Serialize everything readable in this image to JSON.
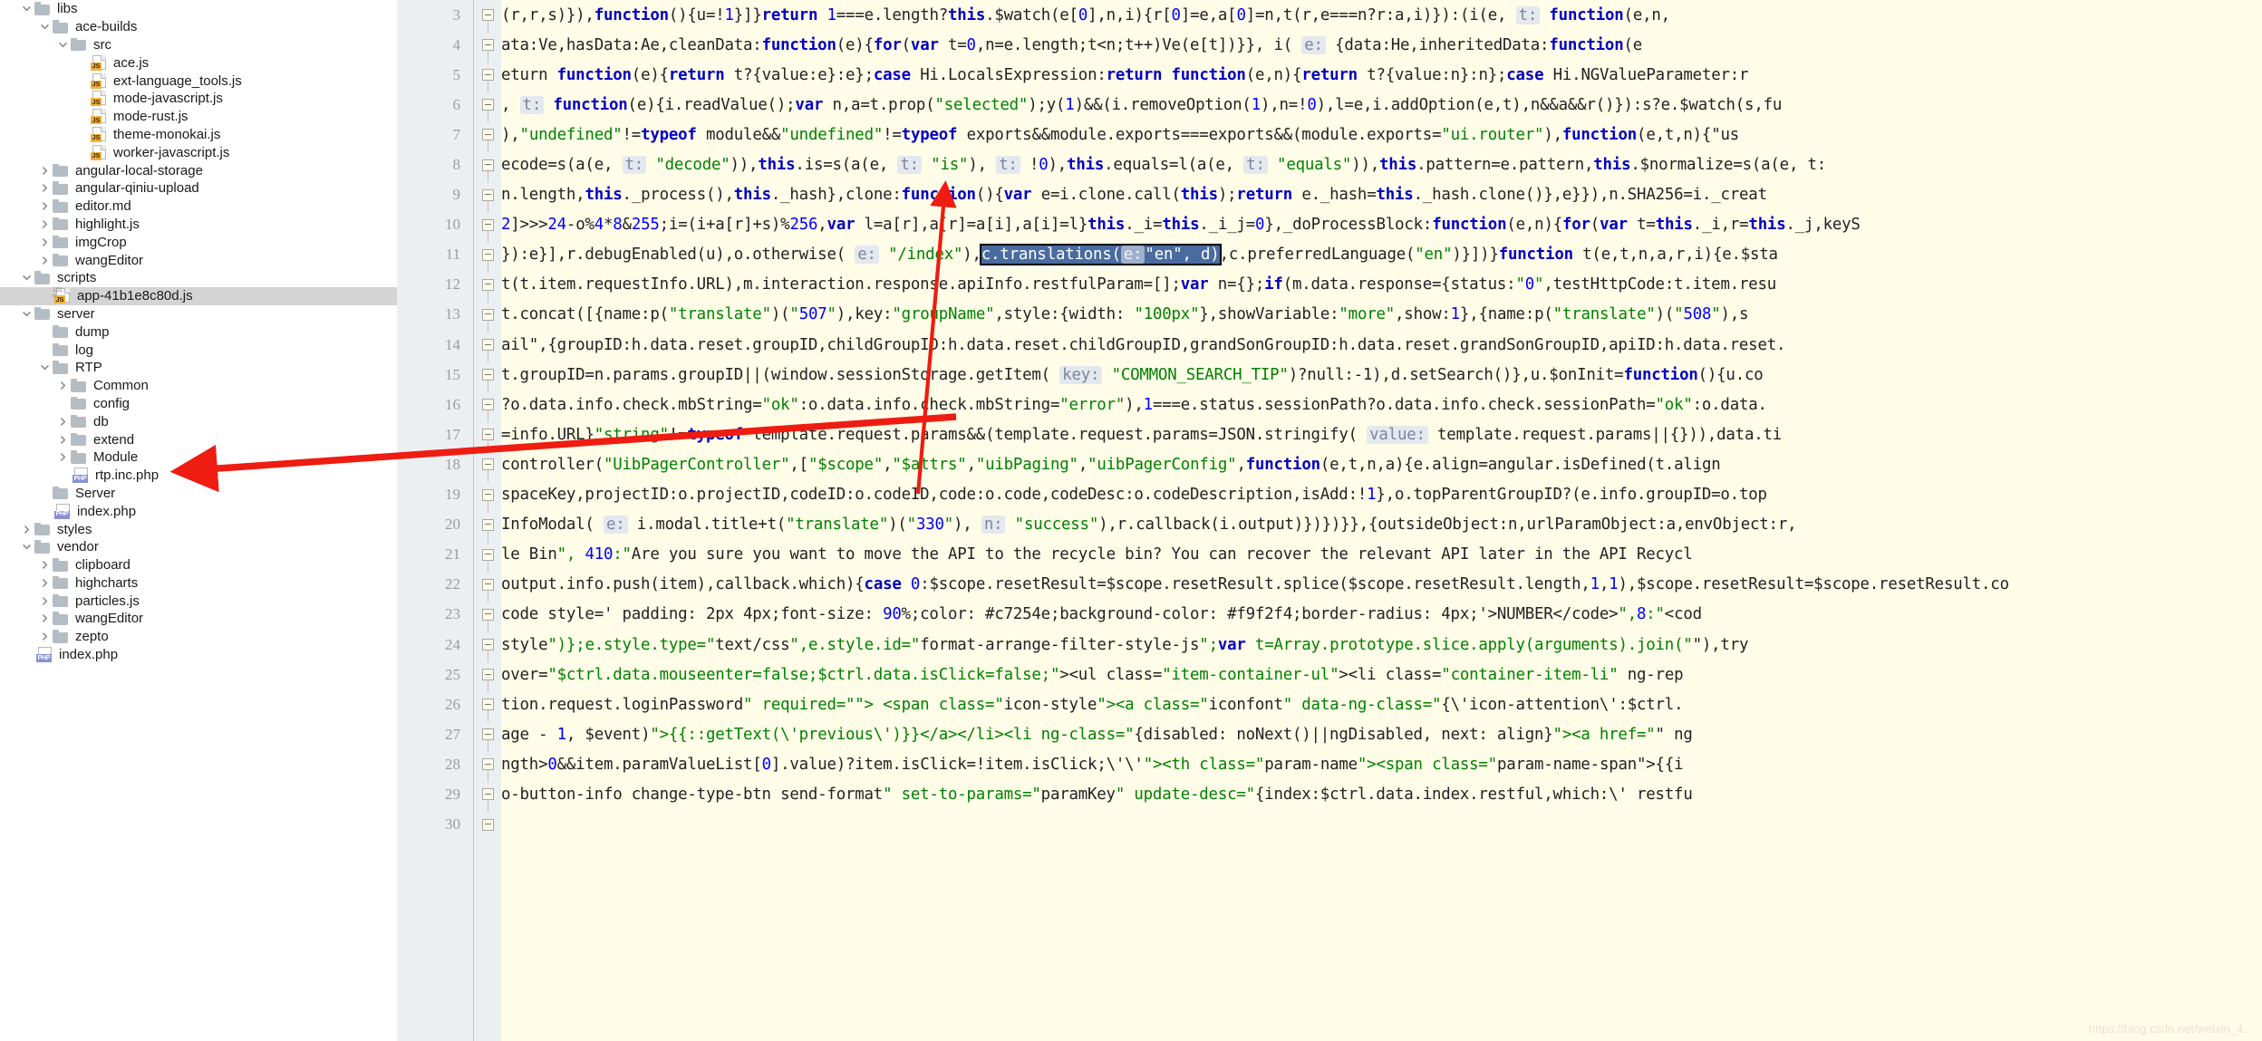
{
  "tree": {
    "items": [
      {
        "label": "libs",
        "depth": 1,
        "type": "folder",
        "twisty": "down",
        "selected": false
      },
      {
        "label": "ace-builds",
        "depth": 2,
        "type": "folder",
        "twisty": "down",
        "selected": false
      },
      {
        "label": "src",
        "depth": 3,
        "type": "folder",
        "twisty": "down",
        "selected": false
      },
      {
        "label": "ace.js",
        "depth": 4,
        "type": "js",
        "twisty": "none",
        "selected": false
      },
      {
        "label": "ext-language_tools.js",
        "depth": 4,
        "type": "js",
        "twisty": "none",
        "selected": false
      },
      {
        "label": "mode-javascript.js",
        "depth": 4,
        "type": "js",
        "twisty": "none",
        "selected": false
      },
      {
        "label": "mode-rust.js",
        "depth": 4,
        "type": "js",
        "twisty": "none",
        "selected": false
      },
      {
        "label": "theme-monokai.js",
        "depth": 4,
        "type": "js",
        "twisty": "none",
        "selected": false
      },
      {
        "label": "worker-javascript.js",
        "depth": 4,
        "type": "js",
        "twisty": "none",
        "selected": false
      },
      {
        "label": "angular-local-storage",
        "depth": 2,
        "type": "folder",
        "twisty": "right",
        "selected": false
      },
      {
        "label": "angular-qiniu-upload",
        "depth": 2,
        "type": "folder",
        "twisty": "right",
        "selected": false
      },
      {
        "label": "editor.md",
        "depth": 2,
        "type": "folder",
        "twisty": "right",
        "selected": false
      },
      {
        "label": "highlight.js",
        "depth": 2,
        "type": "folder",
        "twisty": "right",
        "selected": false
      },
      {
        "label": "imgCrop",
        "depth": 2,
        "type": "folder",
        "twisty": "right",
        "selected": false
      },
      {
        "label": "wangEditor",
        "depth": 2,
        "type": "folder",
        "twisty": "right",
        "selected": false
      },
      {
        "label": "scripts",
        "depth": 1,
        "type": "folder",
        "twisty": "down",
        "selected": false
      },
      {
        "label": "app-41b1e8c80d.js",
        "depth": 2,
        "type": "js-min",
        "twisty": "none",
        "selected": true
      },
      {
        "label": "server",
        "depth": 1,
        "type": "folder",
        "twisty": "down",
        "selected": false
      },
      {
        "label": "dump",
        "depth": 2,
        "type": "folder",
        "twisty": "none",
        "selected": false
      },
      {
        "label": "log",
        "depth": 2,
        "type": "folder",
        "twisty": "none",
        "selected": false
      },
      {
        "label": "RTP",
        "depth": 2,
        "type": "folder",
        "twisty": "down",
        "selected": false
      },
      {
        "label": "Common",
        "depth": 3,
        "type": "folder",
        "twisty": "right",
        "selected": false
      },
      {
        "label": "config",
        "depth": 3,
        "type": "folder",
        "twisty": "none",
        "selected": false
      },
      {
        "label": "db",
        "depth": 3,
        "type": "folder",
        "twisty": "right",
        "selected": false
      },
      {
        "label": "extend",
        "depth": 3,
        "type": "folder",
        "twisty": "right",
        "selected": false
      },
      {
        "label": "Module",
        "depth": 3,
        "type": "folder",
        "twisty": "right",
        "selected": false
      },
      {
        "label": "rtp.inc.php",
        "depth": 3,
        "type": "php",
        "twisty": "none",
        "selected": false
      },
      {
        "label": "Server",
        "depth": 2,
        "type": "folder",
        "twisty": "none",
        "selected": false
      },
      {
        "label": "index.php",
        "depth": 2,
        "type": "php",
        "twisty": "none",
        "selected": false
      },
      {
        "label": "styles",
        "depth": 1,
        "type": "folder",
        "twisty": "right",
        "selected": false
      },
      {
        "label": "vendor",
        "depth": 1,
        "type": "folder",
        "twisty": "down",
        "selected": false
      },
      {
        "label": "clipboard",
        "depth": 2,
        "type": "folder",
        "twisty": "right",
        "selected": false
      },
      {
        "label": "highcharts",
        "depth": 2,
        "type": "folder",
        "twisty": "right",
        "selected": false
      },
      {
        "label": "particles.js",
        "depth": 2,
        "type": "folder",
        "twisty": "right",
        "selected": false
      },
      {
        "label": "wangEditor",
        "depth": 2,
        "type": "folder",
        "twisty": "right",
        "selected": false
      },
      {
        "label": "zepto",
        "depth": 2,
        "type": "folder",
        "twisty": "right",
        "selected": false
      },
      {
        "label": "index.php",
        "depth": 1,
        "type": "php",
        "twisty": "none",
        "selected": false
      }
    ],
    "js_badge": "JS",
    "php_badge": "PHP",
    "minified_marker_top": "101",
    "minified_marker_bottom": "0"
  },
  "editor": {
    "line_numbers": [
      "3",
      "4",
      "5",
      "6",
      "7",
      "8",
      "9",
      "10",
      "11",
      "12",
      "13",
      "14",
      "15",
      "16",
      "17",
      "18",
      "19",
      "20",
      "21",
      "22",
      "23",
      "24",
      "25",
      "26",
      "27",
      "28",
      "29",
      "30"
    ],
    "lines": [
      "(r,r,s)}),function(){u=!1}]}return 1===e.length?this.$watch(e[0],n,i){r[0]=e,a[0]=n,t(r,e===n?r:a,i)}):(i(e, t: function(e,n,",
      "ata:Ve,hasData:Ae,cleanData:function(e){for(var t=0,n=e.length;t<n;t++)Ve(e[t])}}, i( e: {data:He,inheritedData:function(e",
      "eturn function(e){return t?{value:e}:e};case Hi.LocalsExpression:return function(e,n){return t?{value:n}:n};case Hi.NGValueParameter:r",
      ", t: function(e){i.readValue();var n,a=t.prop(\"selected\");y(1)&&(i.removeOption(1),n=!0),l=e,i.addOption(e,t),n&&a&&r()}):s?e.$watch(s,fu",
      "),\"undefined\"!=typeof module&&\"undefined\"!=typeof exports&&module.exports===exports&&(module.exports=\"ui.router\"),function(e,t,n){\"us",
      "ecode=s(a(e, t: \"decode\")),this.is=s(a(e, t: \"is\"), t: !0),this.equals=l(a(e, t: \"equals\")),this.pattern=e.pattern,this.$normalize=s(a(e, t:",
      "n.length,this._process(),this._hash},clone:function(){var e=i.clone.call(this);return e._hash=this._hash.clone()},e}}),n.SHA256=i._creat",
      "2]>>>24-o%4*8&255;i=(i+a[r]+s)%256,var l=a[r],a[r]=a[i],a[i]=l}this._i=this._i_j=0},_doProcessBlock:function(e,n){for(var t=this._i,r=this._j,keyS",
      "}):e}],r.debugEnabled(u),o.otherwise( e: \"/index\"),",
      "t(t.item.requestInfo.URL),m.interaction.response.apiInfo.restfulParam=[];var n={};if(m.data.response={status:\"0\",testHttpCode:t.item.resu",
      "t.concat([{name:p(\"translate\")(\"507\"),key:\"groupName\",style:{width: \"100px\"},showVariable:\"more\",show:1},{name:p(\"translate\")(\"508\"),s",
      "ail\",{groupID:h.data.reset.groupID,childGroupID:h.data.reset.childGroupID,grandSonGroupID:h.data.reset.grandSonGroupID,apiID:h.data.reset.",
      "t.groupID=n.params.groupID||(window.sessionStorage.getItem( key: \"COMMON_SEARCH_TIP\")?null:-1),d.setSearch()},u.$onInit=function(){u.co",
      "?o.data.info.check.mbString=\"ok\":o.data.info.check.mbString=\"error\"),1===e.status.sessionPath?o.data.info.check.sessionPath=\"ok\":o.data.",
      "=info.URL}\"string\"!=typeof template.request.params&&(template.request.params=JSON.stringify( value: template.request.params||{})),data.ti",
      "controller(\"UibPagerController\",[\"$scope\",\"$attrs\",\"uibPaging\",\"uibPagerConfig\",function(e,t,n,a){e.align=angular.isDefined(t.align",
      "spaceKey,projectID:o.projectID,codeID:o.codeID,code:o.code,codeDesc:o.codeDescription,isAdd:!1},o.topParentGroupID?(e.info.groupID=o.top",
      "InfoModal( e: i.modal.title+t(\"translate\")(\"330\"), n: \"success\"),r.callback(i.output)})})}},{outsideObject:n,urlParamObject:a,envObject:r,",
      "le Bin\", 410:\"Are you sure you want to move the API to the recycle bin? You can recover the relevant API later in the API Recycl",
      "output.info.push(item),callback.which){case 0:$scope.resetResult=$scope.resetResult.splice($scope.resetResult.length,1,1),$scope.resetResult=$scope.resetResult.co",
      "code style=' padding: 2px 4px;font-size: 90%;color: #c7254e;background-color: #f9f2f4;border-radius: 4px;'>NUMBER</code>\",8:\"<cod",
      "style\")};e.style.type=\"text/css\",e.style.id=\"format-arrange-filter-style-js\";var t=Array.prototype.slice.apply(arguments).join(\"\"),try",
      "over=\"$ctrl.data.mouseenter=false;$ctrl.data.isClick=false;\"><ul class=\"item-container-ul\"><li class=\"container-item-li\" ng-rep",
      "tion.request.loginPassword\" required=\"\"> <span class=\"icon-style\"><a class=\"iconfont\" data-ng-class=\"{\\'icon-attention\\':$ctrl.",
      "age - 1, $event)\">{{::getText(\\'previous\\')}}</a></li><li ng-class=\"{disabled: noNext()||ngDisabled, next: align}\"><a href=\"\" ng",
      "ngth>0&&item.paramValueList[0].value)?item.isClick=!item.isClick;\\'\\'\"><th class=\"param-name\"><span class=\"param-name-span\">{{i",
      "o-button-info change-type-btn send-format\" set-to-params=\"paramKey\" update-desc=\"{index:$ctrl.data.index.restful,which:\\' restfu",
      ""
    ],
    "selection": {
      "prefix": "}):e}],r.debugEnabled(u),o.otherwise( e: \"/index\"),",
      "text_a": "c.translations(",
      "hint": "e:",
      "text_b": "\"en\", d)",
      "suffix": ",c.preferredLanguage(\"en\")}])}function t(e,t,n,a,r,i){e.$sta"
    }
  },
  "annotation": {
    "arrow_color": "#ee1c11",
    "arrow_count": 2
  },
  "watermark": {
    "text": "https://blog.csdn.net/weixin_4..."
  }
}
